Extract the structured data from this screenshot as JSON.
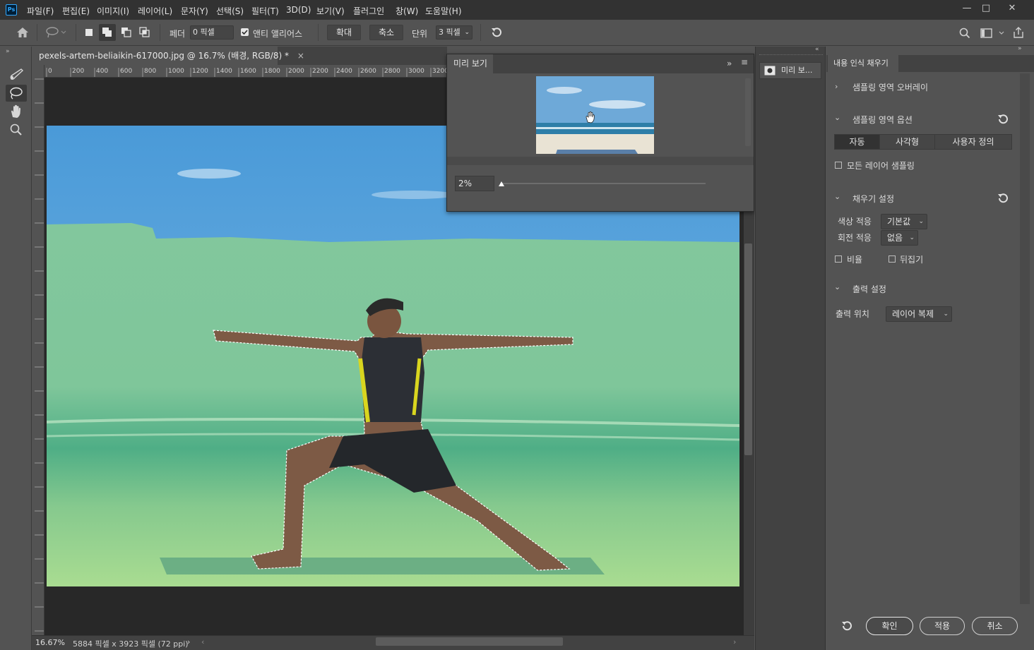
{
  "app": {
    "logo": "Ps",
    "menu": [
      "파일(F)",
      "편집(E)",
      "이미지(I)",
      "레이어(L)",
      "문자(Y)",
      "선택(S)",
      "필터(T)",
      "3D(D)",
      "보기(V)",
      "플러그인",
      "창(W)",
      "도움말(H)"
    ],
    "window_controls": [
      "—",
      "□",
      "✕"
    ]
  },
  "options_bar": {
    "feather_label": "페더",
    "feather_value": "0 픽셀",
    "antialias_label": "앤티 앨리어스",
    "expand_label": "확대",
    "contract_label": "축소",
    "unit_label": "단위",
    "unit_value": "3 픽셀"
  },
  "document": {
    "tab_title": "pexels-artem-beliaikin-617000.jpg @ 16.7% (배경, RGB/8) *",
    "tab_close": "×",
    "ruler_top": [
      "0",
      "200",
      "400",
      "600",
      "800",
      "1000",
      "1200",
      "1400",
      "1600",
      "1800",
      "2000",
      "2200",
      "2400",
      "2600",
      "2800",
      "3000",
      "3200"
    ],
    "status_zoom": "16.67%",
    "status_info": "5884 픽셀 x 3923 픽셀 (72 ppi)"
  },
  "preview_panel": {
    "tab": "미리 보기",
    "zoom_value": "2%"
  },
  "dock": {
    "preview_button": "미리 보..."
  },
  "content_aware_fill": {
    "tab": "내용 인식 채우기",
    "sampling_overlay": "샘플링 영역 오버레이",
    "sampling_options": "샘플링 영역 옵션",
    "modes": [
      "자동",
      "사각형",
      "사용자 정의"
    ],
    "sample_all_layers": "모든 레이어 샘플링",
    "fill_settings": "채우기 설정",
    "color_adapt_label": "색상 적응",
    "color_adapt_value": "기본값",
    "rotation_adapt_label": "회전 적응",
    "rotation_adapt_value": "없음",
    "scale_label": "비율",
    "mirror_label": "뒤집기",
    "output_settings": "출력 설정",
    "output_to_label": "출력 위치",
    "output_to_value": "레이어 복제",
    "ok": "확인",
    "apply": "적용",
    "cancel": "취소"
  }
}
